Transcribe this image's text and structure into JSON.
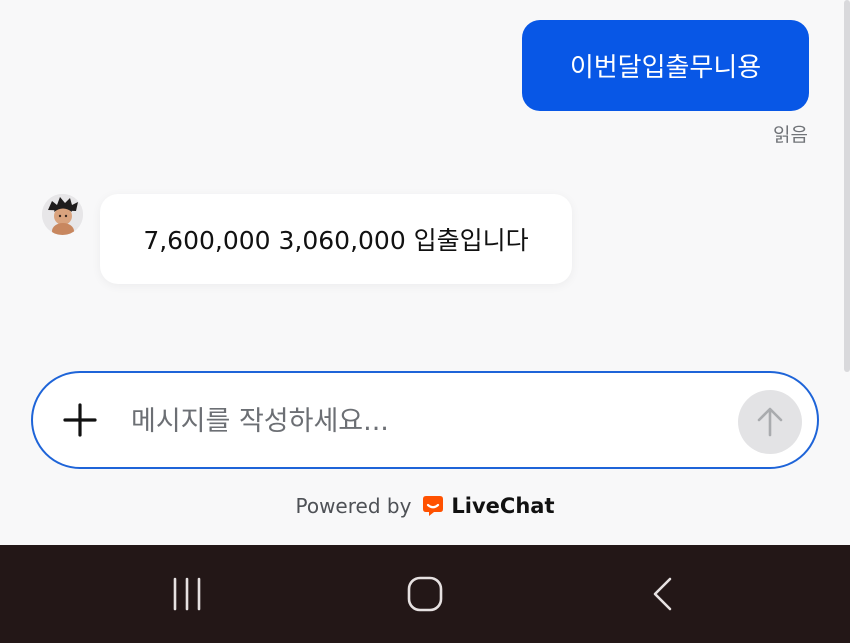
{
  "conversation": {
    "outgoing_message": "이번달입출무니용",
    "read_status": "읽음",
    "incoming_message": "7,600,000 3,060,000 입출입니다"
  },
  "composer": {
    "placeholder": "메시지를 작성하세요..."
  },
  "footer": {
    "powered_by": "Powered by",
    "brand": "LiveChat"
  },
  "icons": {
    "attach": "plus-icon",
    "send": "arrow-up-icon",
    "brand_logo": "livechat-logo-icon",
    "nav": [
      "recent-apps-icon",
      "home-icon",
      "back-icon"
    ]
  },
  "colors": {
    "accent": "#0857e6",
    "input_border": "#1e64d8",
    "brand_orange": "#ff5100",
    "navbar": "#231717"
  }
}
